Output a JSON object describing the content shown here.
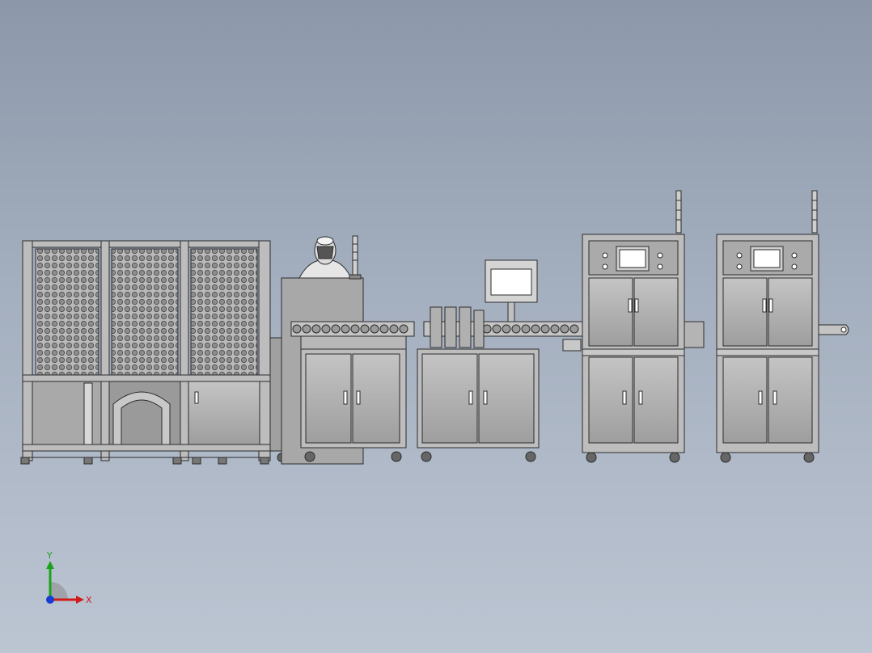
{
  "viewport": {
    "background_top": "#8c98aa",
    "background_bottom": "#bcc5d2"
  },
  "model": {
    "line_color": "#2b2b2b",
    "panel_fill": "#a6a6a6",
    "frame_fill": "#bdbdbd",
    "screen_fill": "#ffffff"
  },
  "triad": {
    "x_label": "X",
    "y_label": "Y",
    "x_color": "#d11a1a",
    "y_color": "#1aa31a",
    "z_color": "#1a3ad1",
    "icon": "coordinate-triad-icon"
  }
}
